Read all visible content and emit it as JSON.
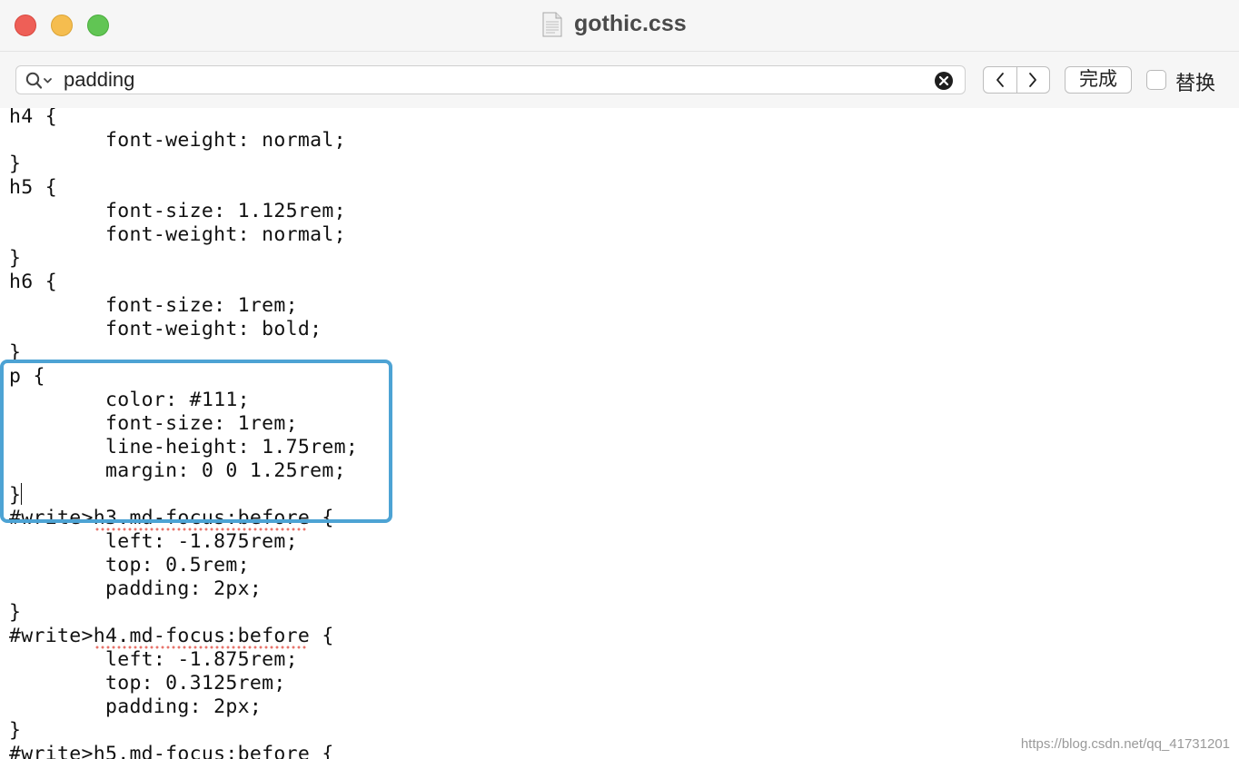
{
  "window": {
    "title": "gothic.css",
    "file_icon": "document-icon"
  },
  "findbar": {
    "search_value": "padding",
    "done_label": "完成",
    "replace_label": "替换",
    "replace_checked": false
  },
  "editor": {
    "lines": [
      "h4 {",
      "        font-weight: normal;",
      "}",
      "h5 {",
      "        font-size: 1.125rem;",
      "        font-weight: normal;",
      "}",
      "h6 {",
      "        font-size: 1rem;",
      "        font-weight: bold;",
      "}",
      "p {",
      "        color: #111;",
      "        font-size: 1rem;",
      "        line-height: 1.75rem;",
      "        margin: 0 0 1.25rem;",
      "}",
      "#write>h3.md-focus:before {",
      "        left: -1.875rem;",
      "        top: 0.5rem;",
      "        padding: 2px;",
      "}",
      "#write>h4.md-focus:before {",
      "        left: -1.875rem;",
      "        top: 0.3125rem;",
      "        padding: 2px;",
      "}",
      "#write>h5.md-focus:before {"
    ]
  },
  "watermark": "https://blog.csdn.net/qq_41731201",
  "colors": {
    "highlight_box": "#4da3d4",
    "spell_squiggle": "#e8736b"
  }
}
